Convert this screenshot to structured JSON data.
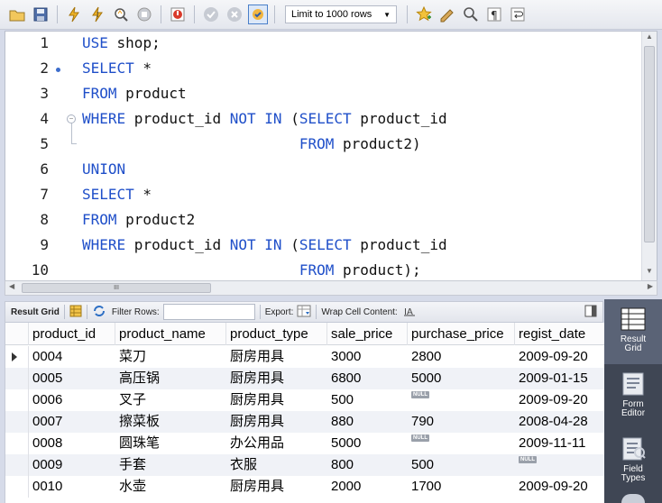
{
  "toolbar": {
    "limit_label": "Limit to 1000 rows",
    "icons": [
      "folder-icon",
      "save-icon",
      "execute-icon",
      "execute-current-icon",
      "explain-icon",
      "stop-icon",
      "toggle-error-icon",
      "commit-icon",
      "rollback-icon",
      "autocommit-icon",
      "limit-dropdown",
      "bookmark-icon",
      "beautify-icon",
      "find-icon",
      "invisible-chars-icon",
      "wrap-icon"
    ]
  },
  "editor": {
    "lines": [
      {
        "num": "1",
        "tokens": [
          {
            "t": "USE",
            "k": true
          },
          {
            "t": " shop;",
            "k": false
          }
        ]
      },
      {
        "num": "2",
        "tokens": [
          {
            "t": "SELECT",
            "k": true
          },
          {
            "t": " *",
            "k": false
          }
        ]
      },
      {
        "num": "3",
        "tokens": [
          {
            "t": "FROM",
            "k": true
          },
          {
            "t": " product",
            "k": false
          }
        ]
      },
      {
        "num": "4",
        "tokens": [
          {
            "t": "WHERE",
            "k": true
          },
          {
            "t": " product_id ",
            "k": false
          },
          {
            "t": "NOT IN",
            "k": true
          },
          {
            "t": " (",
            "k": false
          },
          {
            "t": "SELECT",
            "k": true
          },
          {
            "t": " product_id",
            "k": false
          }
        ]
      },
      {
        "num": "5",
        "tokens": [
          {
            "t": "                         ",
            "k": false
          },
          {
            "t": "FROM",
            "k": true
          },
          {
            "t": " product2)",
            "k": false
          }
        ]
      },
      {
        "num": "6",
        "tokens": [
          {
            "t": "UNION",
            "k": true
          }
        ]
      },
      {
        "num": "7",
        "tokens": [
          {
            "t": "SELECT",
            "k": true
          },
          {
            "t": " *",
            "k": false
          }
        ]
      },
      {
        "num": "8",
        "tokens": [
          {
            "t": "FROM",
            "k": true
          },
          {
            "t": " product2",
            "k": false
          }
        ]
      },
      {
        "num": "9",
        "tokens": [
          {
            "t": "WHERE",
            "k": true
          },
          {
            "t": " product_id ",
            "k": false
          },
          {
            "t": "NOT IN",
            "k": true
          },
          {
            "t": " (",
            "k": false
          },
          {
            "t": "SELECT",
            "k": true
          },
          {
            "t": " product_id",
            "k": false
          }
        ]
      },
      {
        "num": "10",
        "tokens": [
          {
            "t": "                         ",
            "k": false
          },
          {
            "t": "FROM",
            "k": true
          },
          {
            "t": " product);",
            "k": false
          }
        ]
      }
    ]
  },
  "result_bar": {
    "result_grid": "Result Grid",
    "filter_rows": "Filter Rows:",
    "filter_value": "",
    "export": "Export:",
    "wrap_cell": "Wrap Cell Content:"
  },
  "grid": {
    "columns": [
      "product_id",
      "product_name",
      "product_type",
      "sale_price",
      "purchase_price",
      "regist_date"
    ],
    "rows": [
      [
        "0004",
        "菜刀",
        "厨房用具",
        "3000",
        "2800",
        "2009-09-20"
      ],
      [
        "0005",
        "高压锅",
        "厨房用具",
        "6800",
        "5000",
        "2009-01-15"
      ],
      [
        "0006",
        "叉子",
        "厨房用具",
        "500",
        "NULL",
        "2009-09-20"
      ],
      [
        "0007",
        "擦菜板",
        "厨房用具",
        "880",
        "790",
        "2008-04-28"
      ],
      [
        "0008",
        "圆珠笔",
        "办公用品",
        "5000",
        "NULL",
        "2009-11-11"
      ],
      [
        "0009",
        "手套",
        "衣服",
        "800",
        "500",
        "NULL"
      ],
      [
        "0010",
        "水壶",
        "厨房用具",
        "2000",
        "1700",
        "2009-09-20"
      ]
    ]
  },
  "side_panel": {
    "items": [
      {
        "label1": "Result",
        "label2": "Grid"
      },
      {
        "label1": "Form",
        "label2": "Editor"
      },
      {
        "label1": "Field",
        "label2": "Types"
      }
    ]
  },
  "colors": {
    "keyword": "#1f4fc9",
    "side_bg": "#3f4654",
    "side_active": "#5a6376"
  }
}
